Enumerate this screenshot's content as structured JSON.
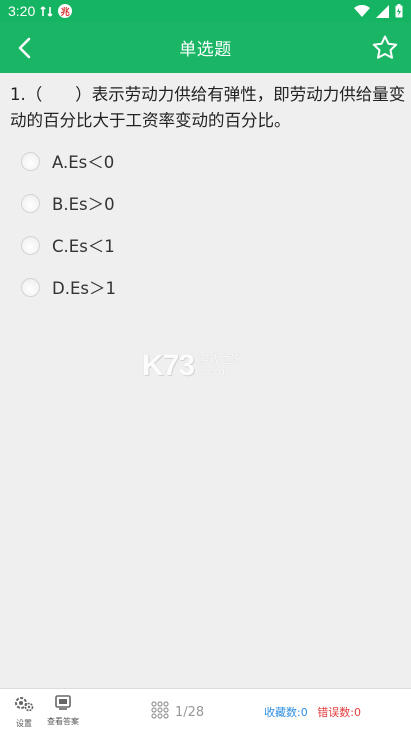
{
  "status_bar": {
    "time": "3:20",
    "icons": [
      "data-sync-icon",
      "notification-badge-icon",
      "wifi-icon",
      "signal-icon",
      "battery-icon"
    ],
    "badge_text": "兆"
  },
  "app_bar": {
    "title": "单选题",
    "back_icon": "chevron-left-icon",
    "favorite_icon": "star-outline-icon"
  },
  "question": {
    "text": "1.（　　）表示劳动力供给有弹性，即劳动力供给量变动的百分比大于工资率变动的百分比。",
    "options": [
      {
        "label": "A.Es＜0"
      },
      {
        "label": "B.Es＞0"
      },
      {
        "label": "C.Es＜1"
      },
      {
        "label": "D.Es＞1"
      }
    ]
  },
  "watermark": {
    "brand": "K73",
    "cn": "游戏之家",
    "domain": ".com"
  },
  "bottom_bar": {
    "settings_label": "设置",
    "answer_label": "查看答案",
    "progress": "1/28",
    "favorites": "收藏数:0",
    "errors": "错误数:0"
  },
  "colors": {
    "primary": "#1ab665",
    "favorites_text": "#2e8fe0",
    "errors_text": "#e23b3b"
  }
}
